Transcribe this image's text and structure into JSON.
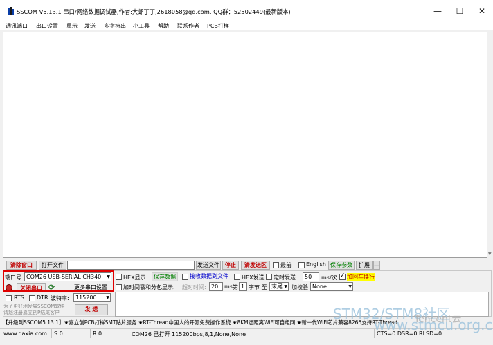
{
  "window": {
    "title": "SSCOM V5.13.1 串口/网络数据调试器,作者:大虾丁丁,2618058@qq.com. QQ群：52502449(最新版本)",
    "minimize": "—",
    "maximize": "☐",
    "close": "✕"
  },
  "menu": [
    "通讯端口",
    "串口设置",
    "显示",
    "发送",
    "多字符串",
    "小工具",
    "帮助",
    "联系作者",
    "PCB打样"
  ],
  "toolbar1": {
    "clear_window": "清除窗口",
    "open_file": "打开文件",
    "send_file": "发送文件",
    "stop": "停止",
    "clear_send": "清发送区",
    "latest": "最前",
    "english": "English",
    "save_params": "保存参数",
    "expand": "扩展",
    "collapse": "—"
  },
  "port": {
    "label": "端口号",
    "value": "COM26 USB-SERIAL CH340",
    "close_button": "关闭串口",
    "more_settings": "更多串口设置",
    "rts": "RTS",
    "dtr": "DTR",
    "baud_label": "波特率:",
    "baud_value": "115200"
  },
  "options": {
    "hex_display": "HEX显示",
    "save_data": "保存数据",
    "recv_to_file": "接收数据到文件",
    "hex_send": "HEX发送",
    "timed_send": "定时发送:",
    "interval_value": "50",
    "interval_unit": "ms/次",
    "add_crlf_checked": true,
    "add_crlf": "加回车换行",
    "timestamp_split": "加时间戳和分包显示.",
    "timeout_label": "超时时间:",
    "timeout_value": "20",
    "timeout_unit": "ms",
    "nth_label": "第",
    "nth_value": "1",
    "bytes_label": "字节 至",
    "end_value": "末尾",
    "checksum_label": "加校验",
    "checksum_value": "None"
  },
  "send_button": "发 送",
  "promo_text": "为了更好地发展SSCOM软件\n请您注册嘉立创P结尾客户",
  "ad_line": "【升级到SSCOM5.13.1】★嘉立创PCB打样SMT贴片服务 ★RT-Thread中国人的开源免费操作系统 ★8KM远距离WiFi可自组网 ★新一代WiFi芯片兼容8266支持RT-Thread",
  "status": {
    "website": "www.daxia.com",
    "sent": "S:0",
    "received": "R:0",
    "port_state": "COM26 已打开  115200bps,8,1,None,None",
    "signals": "CTS=0 DSR=0 RLSD=0"
  },
  "watermarks": {
    "line1": "STM32/STM8社区",
    "line2": "www.stmcu.org.cn",
    "tencent": "Tencent云"
  }
}
